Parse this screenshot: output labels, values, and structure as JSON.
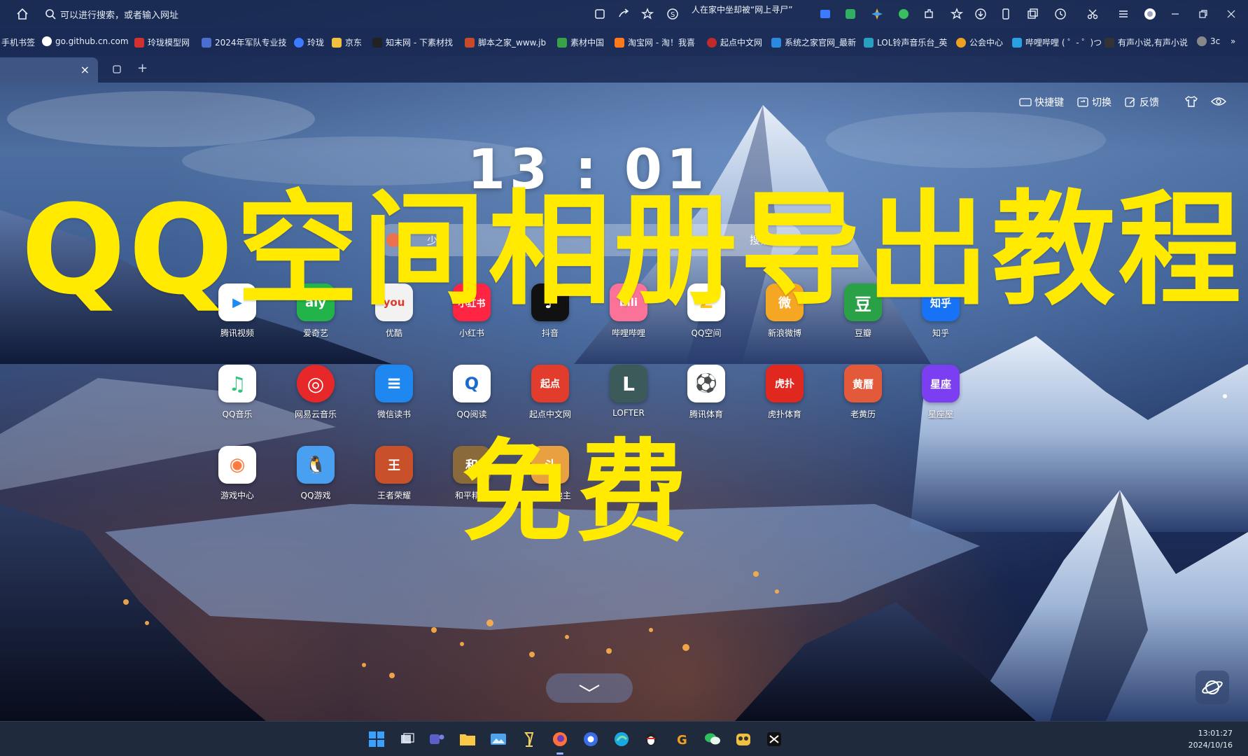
{
  "address_bar": {
    "placeholder": "可以进行搜索，或者输入网址",
    "hot_search": "人在家中坐却被“网上寻尸”"
  },
  "bookmarks": [
    {
      "label": "手机书签",
      "color": "#3a4a6a"
    },
    {
      "label": "go.github.cn.com",
      "color": "#ffffff"
    },
    {
      "label": "玲珑模型网",
      "color": "#d33030"
    },
    {
      "label": "2024年军队专业技",
      "color": "#4a6fd0"
    },
    {
      "label": "玲珑",
      "color": "#3c7bff"
    },
    {
      "label": "京东",
      "color": "#f0c040"
    },
    {
      "label": "知末网 - 下素材找",
      "color": "#222222"
    },
    {
      "label": "脚本之家_www.jb",
      "color": "#c84a2a"
    },
    {
      "label": "素材中国",
      "color": "#3aa04a"
    },
    {
      "label": "淘宝网 - 淘！我喜",
      "color": "#ff7a1a"
    },
    {
      "label": "起点中文网",
      "color": "#c02a2a"
    },
    {
      "label": "系统之家官网_最新",
      "color": "#2a8ae0"
    },
    {
      "label": "LOL铃声音乐台_英",
      "color": "#2aa0c0"
    },
    {
      "label": "公会中心",
      "color": "#f0a020"
    },
    {
      "label": "哔哩哔哩 ( ゜- ゜)つ",
      "color": "#2aa0e0"
    },
    {
      "label": "有声小说,有声小说",
      "color": "#333333"
    },
    {
      "label": "3c",
      "color": "#888888"
    }
  ],
  "tabs": {
    "active_tab_label": "",
    "close": "×",
    "new_tab": "+"
  },
  "tools": {
    "shortcut": "快捷键",
    "switch": "切换",
    "feedback": "反馈"
  },
  "clock": "13 : 01",
  "search": {
    "hint": "少女",
    "button": "搜索"
  },
  "apps": [
    {
      "label": "腾讯视频",
      "text": "▶",
      "color": "#1c8cf0"
    },
    {
      "label": "爱奇艺",
      "text": "aiy",
      "color": "#22b34a"
    },
    {
      "label": "优酷",
      "text": "you",
      "color": "#f2f2f2"
    },
    {
      "label": "小红书",
      "text": "小红书",
      "color": "#ff2442"
    },
    {
      "label": "抖音",
      "text": "♪",
      "color": "#111111"
    },
    {
      "label": "哔哩哔哩",
      "text": "bili",
      "color": "#fb7299"
    },
    {
      "label": "QQ空间",
      "text": "Z",
      "color": "#ffc61a"
    },
    {
      "label": "新浪微博",
      "text": "微",
      "color": "#f5a623"
    },
    {
      "label": "豆瓣",
      "text": "豆",
      "color": "#2aa147"
    },
    {
      "label": "知乎",
      "text": "知乎",
      "color": "#1772f6"
    },
    {
      "label": "QQ音乐",
      "text": "♫",
      "color": "#ffffff"
    },
    {
      "label": "网易云音乐",
      "text": "◎",
      "color": "#e6282b"
    },
    {
      "label": "微信读书",
      "text": "≡",
      "color": "#1e88f0"
    },
    {
      "label": "QQ阅读",
      "text": "Q",
      "color": "#ffffff"
    },
    {
      "label": "起点中文网",
      "text": "起点",
      "color": "#e23c2c"
    },
    {
      "label": "LOFTER",
      "text": "L",
      "color": "#3d5a5a"
    },
    {
      "label": "腾讯体育",
      "text": "⚽",
      "color": "#ffffff"
    },
    {
      "label": "虎扑体育",
      "text": "虎扑",
      "color": "#e0281e"
    },
    {
      "label": "老黄历",
      "text": "黄曆",
      "color": "#e25a3a"
    },
    {
      "label": "星座屋",
      "text": "星座",
      "color": "#7b3ef0"
    },
    {
      "label": "游戏中心",
      "text": "◉",
      "color": "#ffffff"
    },
    {
      "label": "QQ游戏",
      "text": "🐧",
      "color": "#4aa0f0"
    },
    {
      "label": "王者荣耀",
      "text": "王",
      "color": "#c8502a"
    },
    {
      "label": "和平精英",
      "text": "和",
      "color": "#8a6a3a"
    },
    {
      "label": "欢乐斗地主",
      "text": "斗",
      "color": "#e8a040"
    }
  ],
  "overlay": {
    "title": "QQ空间相册导出教程",
    "free": "免费"
  },
  "taskbar": {
    "time": "13:01:27",
    "date": "2024/10/16"
  }
}
